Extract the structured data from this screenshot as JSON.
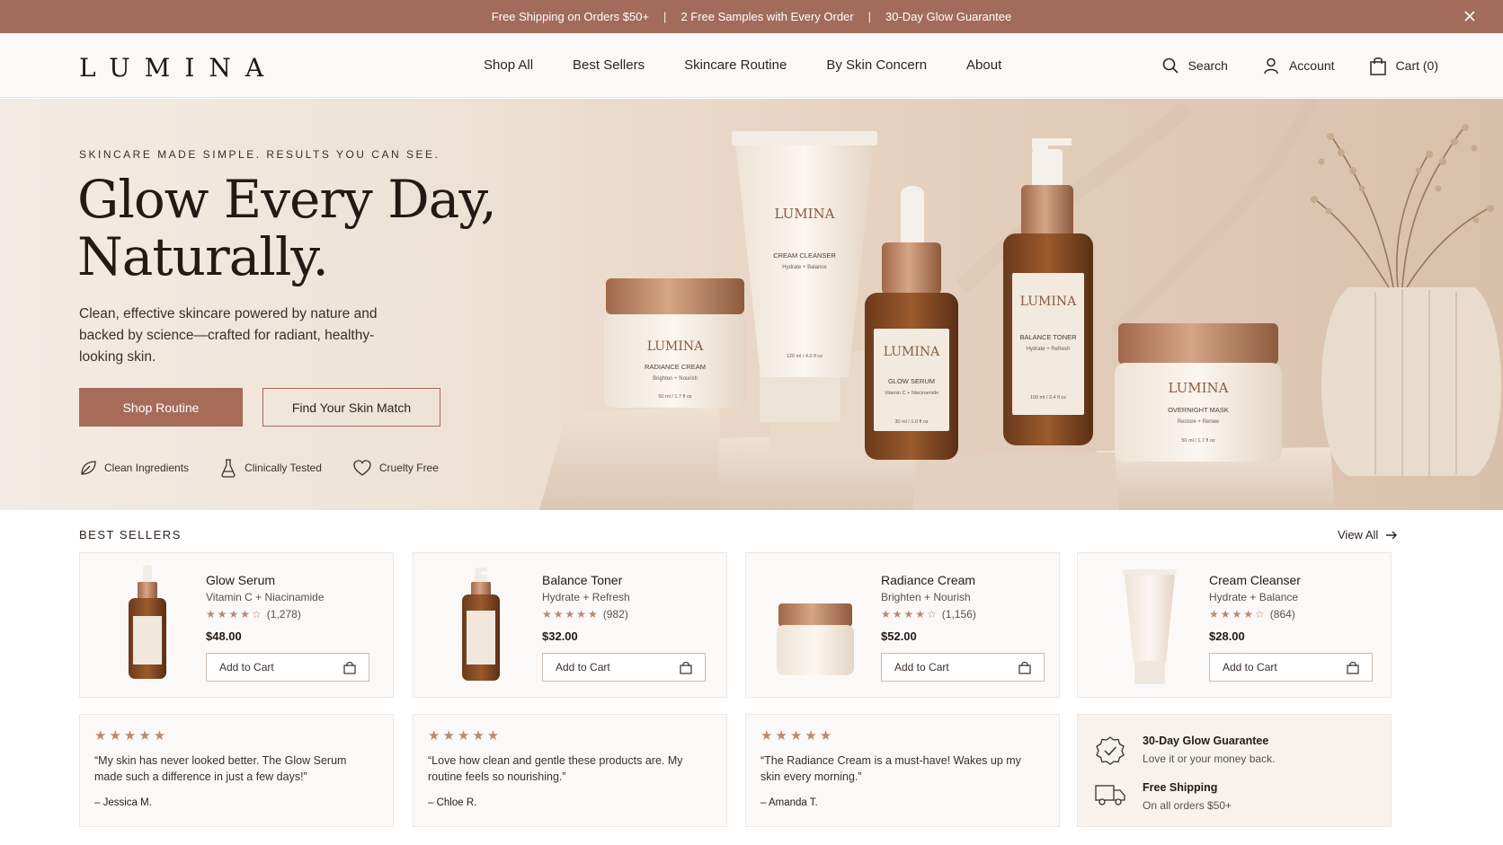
{
  "announcement": {
    "items": [
      "Free Shipping on Orders $50+",
      "2 Free Samples with Every Order",
      "30-Day Glow Guarantee"
    ],
    "separator": "|"
  },
  "nav": {
    "logo": "LUMINA",
    "menu": [
      "Shop All",
      "Best Sellers",
      "Skincare Routine",
      "By Skin Concern",
      "About"
    ],
    "search": "Search",
    "account": "Account",
    "cart": "Cart (0)"
  },
  "hero": {
    "kicker": "SKINCARE MADE SIMPLE. RESULTS YOU CAN SEE.",
    "headline_line1": "Glow Every Day,",
    "headline_line2": "Naturally.",
    "subtext": "Clean, effective skincare powered by nature and backed by science—crafted for radiant, healthy-looking skin.",
    "primary_cta": "Shop Routine",
    "secondary_cta": "Find Your Skin Match",
    "features": [
      "Clean Ingredients",
      "Clinically Tested",
      "Cruelty Free"
    ],
    "product_labels": {
      "brand": "LUMINA",
      "radiance_cream": "RADIANCE CREAM",
      "radiance_sub": "Brighten + Nourish",
      "radiance_size": "50 ml / 1.7 fl oz",
      "cleanser": "CREAM CLEANSER",
      "cleanser_sub": "Hydrate + Balance",
      "cleanser_size": "120 ml / 4.0 fl oz",
      "serum": "GLOW SERUM",
      "serum_sub": "Vitamin C + Niacinamide",
      "serum_size": "30 ml / 1.0 fl oz",
      "toner": "BALANCE TONER",
      "toner_sub": "Hydrate + Refresh",
      "toner_size": "100 ml / 3.4 fl oz",
      "mask": "OVERNIGHT MASK",
      "mask_sub": "Restore + Renew",
      "mask_size": "50 ml / 1.7 fl oz"
    }
  },
  "best_sellers": {
    "title": "BEST SELLERS",
    "view_all": "View All",
    "products": [
      {
        "name": "Glow Serum",
        "desc": "Vitamin C + Niacinamide",
        "stars": "★★★★☆",
        "rating": 4.5,
        "count": "(1,278)",
        "price": "$48.00",
        "add": "Add to Cart"
      },
      {
        "name": "Balance Toner",
        "desc": "Hydrate + Refresh",
        "stars": "★★★★★",
        "rating": 5,
        "count": "(982)",
        "price": "$32.00",
        "add": "Add to Cart"
      },
      {
        "name": "Radiance Cream",
        "desc": "Brighten + Nourish",
        "stars": "★★★★☆",
        "rating": 4.5,
        "count": "(1,156)",
        "price": "$52.00",
        "add": "Add to Cart"
      },
      {
        "name": "Cream Cleanser",
        "desc": "Hydrate + Balance",
        "stars": "★★★★☆",
        "rating": 4.5,
        "count": "(864)",
        "price": "$28.00",
        "add": "Add to Cart"
      }
    ]
  },
  "reviews": [
    {
      "stars": "★★★★★",
      "quote": "“My skin has never looked better. The Glow Serum made such a difference in just a few days!”",
      "author": "–  Jessica M."
    },
    {
      "stars": "★★★★★",
      "quote": "“Love how clean and gentle these products are. My routine feels so nourishing.”",
      "author": "–  Chloe R."
    },
    {
      "stars": "★★★★★",
      "quote": "“The Radiance Cream is a must-have! Wakes up my skin every morning.”",
      "author": "–  Amanda T."
    }
  ],
  "guarantees": [
    {
      "title": "30-Day Glow Guarantee",
      "desc": "Love it or your money back.",
      "icon": "badge-check-icon"
    },
    {
      "title": "Free Shipping",
      "desc": "On all orders $50+",
      "icon": "truck-icon"
    }
  ],
  "colors": {
    "accent": "#a76b5a",
    "topbar": "#a36b5b",
    "star": "#b88a6e",
    "text": "#231a15"
  }
}
